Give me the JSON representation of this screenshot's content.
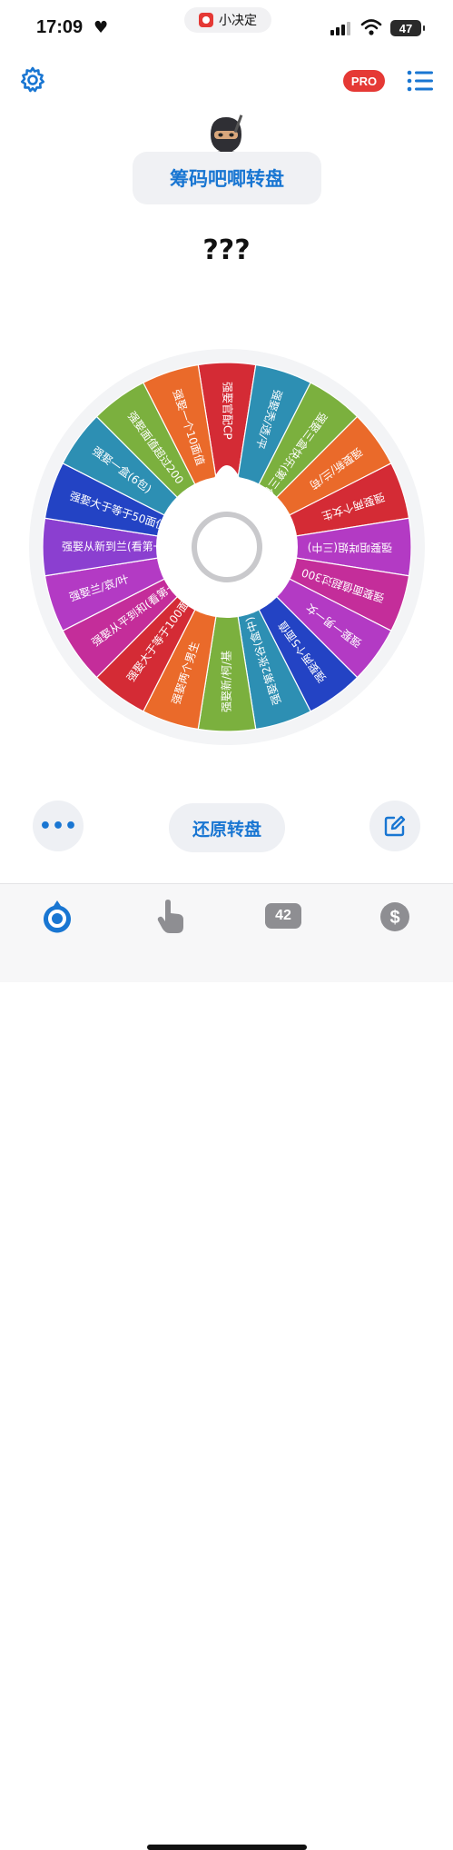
{
  "status": {
    "time": "17:09",
    "battery": "47"
  },
  "island": {
    "app_name": "小决定"
  },
  "header": {
    "pro_label": "PRO"
  },
  "wheel_title": "筹码吧唧转盘",
  "result_text": "???",
  "wheel": {
    "segments": [
      {
        "label": "强娶官配CP",
        "color": "#d42b35"
      },
      {
        "label": "强娶秃/透/平",
        "color": "#2d8fb3"
      },
      {
        "label": "强娶三盒快乐(第三包)",
        "color": "#7bb03e"
      },
      {
        "label": "强娶新/兰/苟",
        "color": "#ea6a2a"
      },
      {
        "label": "强娶两个女生",
        "color": "#d42b35"
      },
      {
        "label": "强娶咀咩姐(三中)",
        "color": "#b33ac4"
      },
      {
        "label": "强娶面值超过300",
        "color": "#c42d9a"
      },
      {
        "label": "强娶一男一女",
        "color": "#b33ac4"
      },
      {
        "label": "强娶两个5面值",
        "color": "#2343c4"
      },
      {
        "label": "强娶第2张谷(盒中)",
        "color": "#2d8fb3"
      },
      {
        "label": "强娶新/柯/基",
        "color": "#7bb03e"
      },
      {
        "label": "强娶两个男生",
        "color": "#ea6a2a"
      },
      {
        "label": "强娶大于等于100面值",
        "color": "#d42b35"
      },
      {
        "label": "强娶从平到和(看第一手)",
        "color": "#c42d9a"
      },
      {
        "label": "强娶兰/哀/叶",
        "color": "#b33ac4"
      },
      {
        "label": "强娶从新到兰(看第一手)",
        "color": "#8b3fd0"
      },
      {
        "label": "强娶大于等于50面值",
        "color": "#2343c4"
      },
      {
        "label": "强娶一盒(6包)",
        "color": "#2d8fb3"
      },
      {
        "label": "强娶面值超过200",
        "color": "#7bb03e"
      },
      {
        "label": "强娶一个10面值",
        "color": "#ea6a2a"
      }
    ]
  },
  "actions": {
    "reset_label": "还原转盘"
  },
  "tabbar": {
    "count_badge": "42"
  },
  "icons": {
    "settings": "gear-icon",
    "menu": "list-icon",
    "more": "ellipsis-icon",
    "edit": "edit-icon",
    "tab_wheel": "wheel-icon",
    "tab_tap": "pointing-hand-icon",
    "tab_count": "counter-icon",
    "tab_money": "dollar-icon"
  },
  "colors": {
    "accent": "#1976d2",
    "pro": "#e53935"
  }
}
